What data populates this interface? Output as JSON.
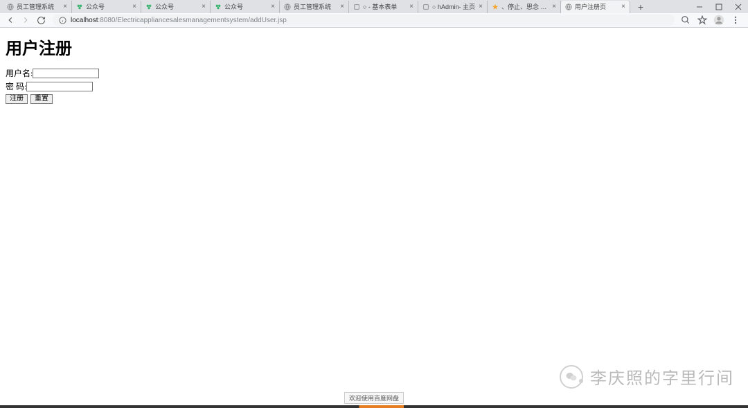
{
  "browser": {
    "tabs": [
      {
        "favicon": "globe",
        "title": "员工管理系统"
      },
      {
        "favicon": "baidu",
        "title": "公众号"
      },
      {
        "favicon": "baidu",
        "title": "公众号"
      },
      {
        "favicon": "baidu",
        "title": "公众号"
      },
      {
        "favicon": "globe",
        "title": "员工管理系统"
      },
      {
        "favicon": "generic",
        "title": "○ - 基本表单"
      },
      {
        "favicon": "generic",
        "title": "○ hAdmin- 主页"
      },
      {
        "favicon": "star",
        "title": "、停止、思念 [http://"
      },
      {
        "favicon": "globe",
        "title": "用户注册页"
      }
    ],
    "active_tab_index": 8,
    "url_host": "localhost",
    "url_port": ":8080",
    "url_path": "/Electricappliancesalesmanagementsystem/addUser.jsp"
  },
  "page": {
    "title": "用户注册",
    "username_label": "用户名:",
    "password_label": "密 码:",
    "username_value": "",
    "password_value": "",
    "register_button": "注册",
    "reset_button": "重置"
  },
  "tooltip": "欢迎使用百度网盘",
  "watermark_text": "李庆照的字里行间"
}
